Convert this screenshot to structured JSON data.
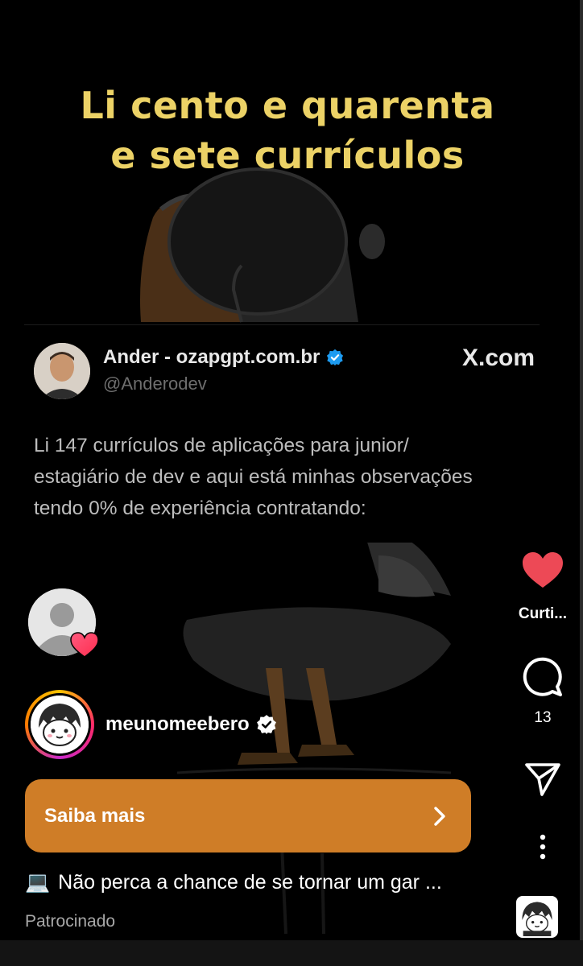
{
  "video": {
    "caption_line1": "Li cento e quarenta",
    "caption_line2": "e sete currículos"
  },
  "tweet": {
    "author_name": "Ander - ozapgpt.com.br",
    "author_handle": "@Anderodev",
    "source": "X.com",
    "text_line1": "Li 147 currículos de aplicações para junior/",
    "text_line2": "estagiário de dev e aqui está minhas observações",
    "text_line3": "tendo 0% de experiência contratando:"
  },
  "creator": {
    "username": "meunomeebero"
  },
  "cta": {
    "label": "Saiba mais"
  },
  "post": {
    "description_emoji": "💻",
    "description": "Não perca a chance de se tornar um gar ...",
    "sponsored_label": "Patrocinado"
  },
  "actions": {
    "like_label": "Curti...",
    "comment_count": "13"
  },
  "colors": {
    "caption_yellow": "#ecd266",
    "cta_orange": "#cf7d27",
    "like_red": "#ed4956",
    "verified_blue": "#1d9bf0"
  }
}
